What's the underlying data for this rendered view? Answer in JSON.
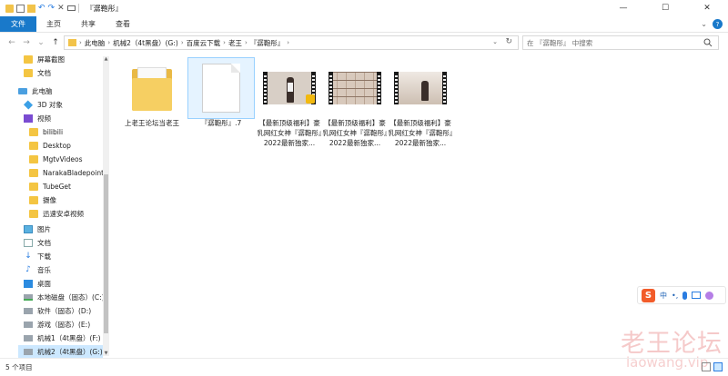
{
  "window": {
    "title": "『潺鞄彤』",
    "controls": {
      "minimize": "—",
      "maximize": "☐",
      "close": "✕"
    }
  },
  "ribbon": {
    "tabs": [
      {
        "label": "文件"
      },
      {
        "label": "主页"
      },
      {
        "label": "共享"
      },
      {
        "label": "查看"
      }
    ],
    "collapse": "⌄",
    "help": "?"
  },
  "nav": {
    "back": "←",
    "forward": "→",
    "recent": "⌄",
    "up": "↑"
  },
  "address": {
    "crumbs": [
      "此电脑",
      "机械2（4t黑盘）(G:)",
      "百度云下载",
      "老王",
      "『潺鞄彤』"
    ],
    "separator": "›",
    "dropdown": "⌄",
    "refresh": "↻"
  },
  "search": {
    "placeholder": "在 『潺鞄彤』 中搜索"
  },
  "sidebar": {
    "items": [
      {
        "label": "屏幕截图",
        "icon": "folder-icon"
      },
      {
        "label": "文档",
        "icon": "folder-icon"
      },
      {
        "label": "此电脑",
        "icon": "computer-icon"
      },
      {
        "label": "3D 对象",
        "icon": "3d-objects-icon"
      },
      {
        "label": "视频",
        "icon": "video-icon"
      },
      {
        "label": "bilibili",
        "icon": "folder-icon"
      },
      {
        "label": "Desktop",
        "icon": "folder-icon"
      },
      {
        "label": "MgtvVideos",
        "icon": "folder-icon"
      },
      {
        "label": "NarakaBladepoint",
        "icon": "folder-icon"
      },
      {
        "label": "TubeGet",
        "icon": "folder-icon"
      },
      {
        "label": "摄像",
        "icon": "folder-icon"
      },
      {
        "label": "迅速安卓视频",
        "icon": "folder-icon"
      },
      {
        "label": "图片",
        "icon": "pictures-icon"
      },
      {
        "label": "文档",
        "icon": "documents-icon"
      },
      {
        "label": "下载",
        "icon": "download-icon"
      },
      {
        "label": "音乐",
        "icon": "music-icon"
      },
      {
        "label": "桌面",
        "icon": "desktop-icon"
      },
      {
        "label": "本地磁盘（固态）(C:)",
        "icon": "drive-icon"
      },
      {
        "label": "软件（固态）(D:)",
        "icon": "drive-icon"
      },
      {
        "label": "游戏（固态）(E:)",
        "icon": "drive-icon"
      },
      {
        "label": "机械1（4t黑盘）(F:)",
        "icon": "drive-icon"
      },
      {
        "label": "机械2（4t黑盘）(G:)",
        "icon": "drive-icon"
      }
    ]
  },
  "files": [
    {
      "name": "上老王论坛当老王",
      "kind": "folder"
    },
    {
      "name": "『潺鞄彤』.7",
      "kind": "blank-file"
    },
    {
      "name": "【最新顶级福利】豪乳网红女神『潺鞄彤』2022最新独家...",
      "kind": "video"
    },
    {
      "name": "【最新顶级福利】豪乳网红女神『潺鞄彤』2022最新独家...",
      "kind": "video"
    },
    {
      "name": "【最新顶级福利】豪乳网红女神『潺鞄彤』2022最新独家...",
      "kind": "video"
    }
  ],
  "status": {
    "item_count": "5 个项目"
  },
  "ime": {
    "logo": "S",
    "lang": "中",
    "punct": "•,"
  },
  "watermark": {
    "cn": "老王论坛",
    "en": "laowang.vip"
  }
}
